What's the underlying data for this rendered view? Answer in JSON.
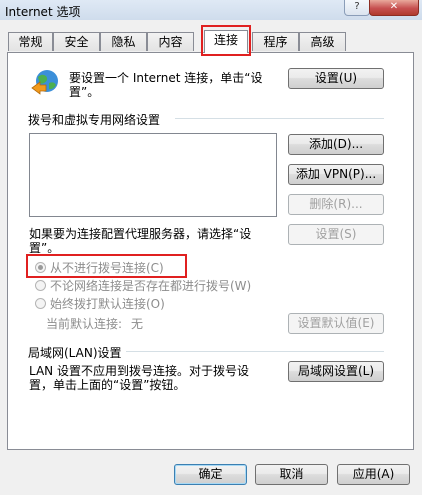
{
  "window": {
    "title": "Internet 选项",
    "help": "?",
    "close": "✕"
  },
  "tabs": [
    "常规",
    "安全",
    "隐私",
    "内容",
    "连接",
    "程序",
    "高级"
  ],
  "setup": {
    "text_line1": "要设置一个 Internet 连接，单击“设",
    "text_line2": "置”。",
    "button": "设置(U)"
  },
  "dialup": {
    "title": "拨号和虚拟专用网络设置",
    "add_button": "添加(D)...",
    "add_vpn_button": "添加 VPN(P)...",
    "remove_button": "删除(R)...",
    "proxy_text_line1": "如果要为连接配置代理服务器，请选择“设",
    "proxy_text_line2": "置”。",
    "settings_button": "设置(S)",
    "radio_never": "从不进行拨号连接(C)",
    "radio_whenever": "不论网络连接是否存在都进行拨号(W)",
    "radio_always": "始终拨打默认连接(O)",
    "current_default_label": "当前默认连接:",
    "current_default_value": "无",
    "set_default_button": "设置默认值(E)"
  },
  "lan": {
    "title": "局域网(LAN)设置",
    "text_line1": "LAN 设置不应用到拨号连接。对于拨号设",
    "text_line2": "置，单击上面的“设置”按钮。",
    "button": "局域网设置(L)"
  },
  "footer": {
    "ok": "确定",
    "cancel": "取消",
    "apply": "应用(A)"
  },
  "colors": {
    "highlight": "#e02020"
  }
}
